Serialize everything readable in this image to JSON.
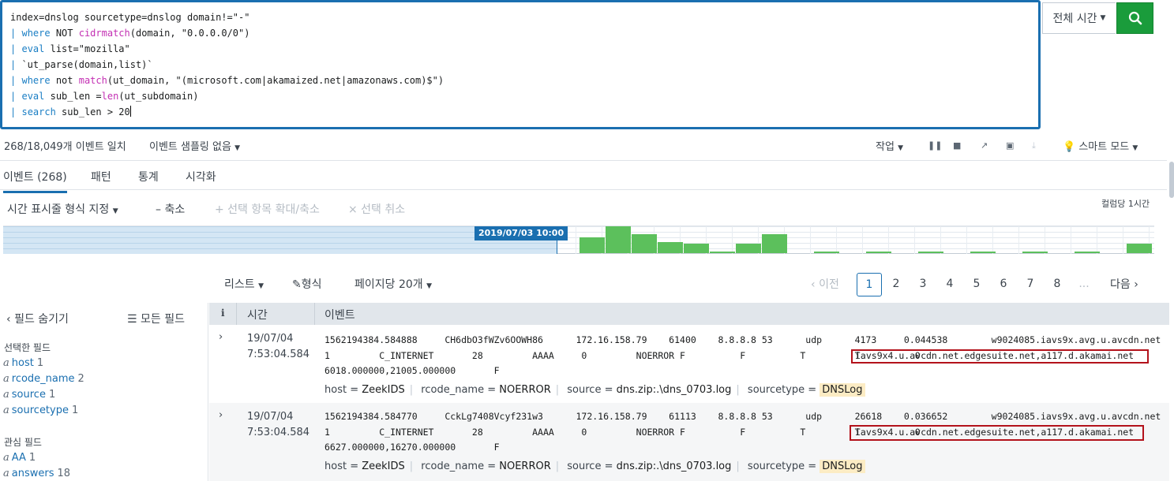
{
  "search": {
    "lines": [
      "index=dnslog sourcetype=dnslog domain!=\"-\"",
      "| where NOT cidrmatch(domain, \"0.0.0.0/0\")",
      "| eval list=\"mozilla\"",
      "| `ut_parse(domain,list)`",
      "| where not match(ut_domain, \"(microsoft.com|akamaized.net|amazonaws.com)$\")",
      "| eval sub_len =len(ut_subdomain)",
      "| search sub_len > 20"
    ],
    "time_range": "전체 시간",
    "search_icon": "search-icon"
  },
  "status": {
    "event_count": "268/18,049개 이벤트 일치",
    "sampling": "이벤트 샘플링 없음",
    "job": "작업",
    "smart_mode": "스마트 모드"
  },
  "tabs": [
    {
      "label": "이벤트 (268)"
    },
    {
      "label": "패턴"
    },
    {
      "label": "통계"
    },
    {
      "label": "시각화"
    }
  ],
  "timeline": {
    "format": "시간 표시줄 형식 지정",
    "zoom_out": "– 축소",
    "zoom_selection": "+ 선택 항목 확대/축소",
    "deselect": "× 선택 취소",
    "scale": "컬럼당 1시간",
    "selected_date": "2019/07/03 10:00",
    "bar_color": "#5cc05c",
    "bars": [
      0.6,
      1.0,
      0.7,
      0.4,
      0.35,
      0.05,
      0.35,
      0.7,
      0.0,
      0.05,
      0.0,
      0.05,
      0.0,
      0.05,
      0.0,
      0.05,
      0.0,
      0.05,
      0.0,
      0.05,
      0.0,
      0.35
    ]
  },
  "results": {
    "list": "리스트",
    "format": "형식",
    "per_page": "페이지당 20개",
    "prev": "이전",
    "pages": [
      "1",
      "2",
      "3",
      "4",
      "5",
      "6",
      "7",
      "8",
      "..."
    ],
    "next": "다음"
  },
  "fields": {
    "hide": "필드 숨기기",
    "all": "모든 필드",
    "selected_header": "선택한 필드",
    "selected": [
      {
        "name": "host",
        "count": "1"
      },
      {
        "name": "rcode_name",
        "count": "2"
      },
      {
        "name": "source",
        "count": "1"
      },
      {
        "name": "sourcetype",
        "count": "1"
      }
    ],
    "interesting_header": "관심 필드",
    "interesting": [
      {
        "name": "AA",
        "count": "1"
      },
      {
        "name": "answers",
        "count": "18"
      }
    ]
  },
  "table": {
    "col_i": "i",
    "col_time": "시간",
    "col_event": "이벤트",
    "rows": [
      {
        "date": "19/07/04",
        "time": "7:53:04.584",
        "line1": "1562194384.584888     CH6dbO3fWZv6OOWH86      172.16.158.79    61400    8.8.8.8 53      udp      4173     0.044538        w9024085.iavs9x.avg.u.avcdn.net",
        "line2": "1         C_INTERNET       28         AAAA     0         NOERROR F          F          T         T          0",
        "highlight": "iavs9x4.u.avcdn.net.edgesuite.net,a117.d.akamai.net",
        "line3": "6018.000000,21005.000000       F",
        "host": "ZeekIDS",
        "rcode_name": "NOERROR",
        "source": "dns.zip:.\\dns_0703.log",
        "sourcetype": "DNSLog"
      },
      {
        "date": "19/07/04",
        "time": "7:53:04.584",
        "line1": "1562194384.584770     CckLg7408Vcyf231w3      172.16.158.79    61113    8.8.8.8 53      udp      26618    0.036652        w9024085.iavs9x.avg.u.avcdn.net",
        "line2": "1         C_INTERNET       28         AAAA     0         NOERROR F          F          T         T          0",
        "highlight": "iavs9x4.u.avcdn.net.edgesuite.net,a117.d.akamai.net",
        "line3": "6627.000000,16270.000000       F",
        "host": "ZeekIDS",
        "rcode_name": "NOERROR",
        "source": "dns.zip:.\\dns_0703.log",
        "sourcetype": "DNSLog"
      }
    ]
  },
  "labels": {
    "host": "host = ",
    "rcode_name": "rcode_name = ",
    "source": "source = ",
    "sourcetype": "sourcetype = "
  }
}
